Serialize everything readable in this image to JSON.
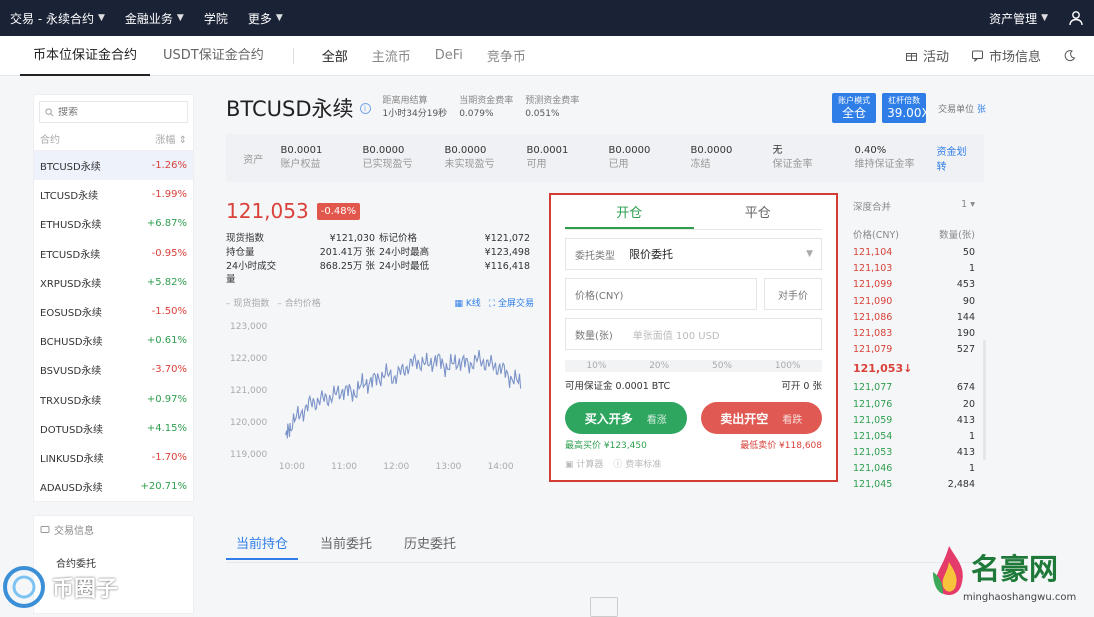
{
  "topnav": {
    "items": [
      "交易 - 永续合约",
      "金融业务",
      "学院",
      "更多"
    ],
    "asset_mgmt": "资产管理"
  },
  "subnav": {
    "tabs": [
      "币本位保证金合约",
      "USDT保证金合约"
    ],
    "categories": [
      "全部",
      "主流币",
      "DeFi",
      "竞争币"
    ],
    "activity": "活动",
    "market_info": "市场信息"
  },
  "sidebar": {
    "search_placeholder": "搜索",
    "col_contract": "合约",
    "col_change": "涨幅",
    "items": [
      {
        "name": "BTCUSD永续",
        "change": "-1.26%",
        "dir": "dn"
      },
      {
        "name": "LTCUSD永续",
        "change": "-1.99%",
        "dir": "dn"
      },
      {
        "name": "ETHUSD永续",
        "change": "+6.87%",
        "dir": "up"
      },
      {
        "name": "ETCUSD永续",
        "change": "-0.95%",
        "dir": "dn"
      },
      {
        "name": "XRPUSD永续",
        "change": "+5.82%",
        "dir": "up"
      },
      {
        "name": "EOSUSD永续",
        "change": "-1.50%",
        "dir": "dn"
      },
      {
        "name": "BCHUSD永续",
        "change": "+0.61%",
        "dir": "up"
      },
      {
        "name": "BSVUSD永续",
        "change": "-3.70%",
        "dir": "dn"
      },
      {
        "name": "TRXUSD永续",
        "change": "+0.97%",
        "dir": "up"
      },
      {
        "name": "DOTUSD永续",
        "change": "+4.15%",
        "dir": "up"
      },
      {
        "name": "LINKUSD永续",
        "change": "-1.70%",
        "dir": "dn"
      },
      {
        "name": "ADAUSD永续",
        "change": "+20.71%",
        "dir": "up"
      }
    ],
    "trade_info": "交易信息",
    "contract_order": "合约委托"
  },
  "title": {
    "name": "BTCUSD永续",
    "settle_label": "距离用结算",
    "settle_value": "1小时34分19秒",
    "cur_rate_label": "当期资金费率",
    "cur_rate_value": "0.079%",
    "pred_rate_label": "预测资金费率",
    "pred_rate_value": "0.051%",
    "account_mode_label": "账户模式",
    "account_mode_value": "全仓",
    "leverage_label": "杠杆倍数",
    "leverage_value": "39.00X",
    "unit_label": "交易单位",
    "unit_value": "张"
  },
  "assets": {
    "label": "资产",
    "cells": [
      {
        "val": "B0.0001",
        "lbl": "账户权益"
      },
      {
        "val": "B0.0000",
        "lbl": "已实现盈亏"
      },
      {
        "val": "B0.0000",
        "lbl": "未实现盈亏"
      },
      {
        "val": "B0.0001",
        "lbl": "可用"
      },
      {
        "val": "B0.0000",
        "lbl": "已用"
      },
      {
        "val": "B0.0000",
        "lbl": "冻结"
      },
      {
        "val": "无",
        "lbl": "保证金率"
      },
      {
        "val": "0.40%",
        "lbl": "维持保证金率"
      }
    ],
    "transfer": "资金划转"
  },
  "price": {
    "last": "121,053",
    "change": "-0.48%"
  },
  "stats": [
    [
      "现货指数",
      "¥121,030",
      "标记价格",
      "¥121,072"
    ],
    [
      "持仓量",
      "201.41万 张",
      "24小时最高",
      "¥123,498"
    ],
    [
      "24小时成交量",
      "868.25万 张",
      "24小时最低",
      "¥116,418"
    ]
  ],
  "chart_legend": {
    "spot": "现货指数",
    "contract": "合约价格",
    "kline": "K线",
    "fullscreen": "全屏交易"
  },
  "chart_data": {
    "type": "line",
    "y_ticks": [
      "123,000",
      "122,000",
      "121,000",
      "120,000",
      "119,000"
    ],
    "x_ticks": [
      "10:00",
      "11:00",
      "12:00",
      "13:00",
      "14:00"
    ],
    "ylim": [
      119000,
      123000
    ],
    "x": [
      9.9,
      10.0,
      10.2,
      10.4,
      10.6,
      10.8,
      11.0,
      11.2,
      11.4,
      11.6,
      11.8,
      12.0,
      12.2,
      12.4,
      12.6,
      12.8,
      13.0,
      13.2,
      13.4,
      13.6,
      13.8,
      14.0,
      14.2,
      14.4
    ],
    "series": [
      {
        "values": [
          119500,
          119900,
          120300,
          120600,
          120700,
          120800,
          121000,
          120900,
          121200,
          121300,
          121500,
          121400,
          121700,
          121900,
          121800,
          121950,
          121700,
          121900,
          121800,
          121950,
          121800,
          121700,
          121400,
          121200
        ]
      }
    ]
  },
  "order": {
    "tab_open": "开仓",
    "tab_close": "平仓",
    "type_label": "委托类型",
    "type_value": "限价委托",
    "price_label": "价格(CNY)",
    "counter_price": "对手价",
    "qty_label": "数量(张)",
    "qty_placeholder": "单张面值 100 USD",
    "pcts": [
      "10%",
      "20%",
      "50%",
      "100%"
    ],
    "avail_label": "可用保证金 0.0001 BTC",
    "can_open": "可开 0 张",
    "buy": "买入开多",
    "buy_sub": "看涨",
    "sell": "卖出开空",
    "sell_sub": "看跌",
    "max_buy": "最高买价 ¥123,450",
    "min_sell": "最低卖价 ¥118,608",
    "calculator": "计算器",
    "fee": "费率标准"
  },
  "depth": {
    "merge_label": "深度合并",
    "merge_value": "1",
    "col_price": "价格(CNY)",
    "col_qty": "数量(张)",
    "asks": [
      [
        "121,104",
        "50"
      ],
      [
        "121,103",
        "1"
      ],
      [
        "121,099",
        "453"
      ],
      [
        "121,090",
        "90"
      ],
      [
        "121,086",
        "144"
      ],
      [
        "121,083",
        "190"
      ],
      [
        "121,079",
        "527"
      ]
    ],
    "mid": "121,053↓",
    "bids": [
      [
        "121,077",
        "674"
      ],
      [
        "121,076",
        "20"
      ],
      [
        "121,059",
        "413"
      ],
      [
        "121,054",
        "1"
      ],
      [
        "121,053",
        "413"
      ],
      [
        "121,046",
        "1"
      ],
      [
        "121,045",
        "2,484"
      ]
    ]
  },
  "bottom_tabs": [
    "当前持仓",
    "当前委托",
    "历史委托"
  ],
  "watermark": {
    "left": "币圈子",
    "right": "名豪网",
    "right_domain": "minghaoshangwu.com"
  }
}
